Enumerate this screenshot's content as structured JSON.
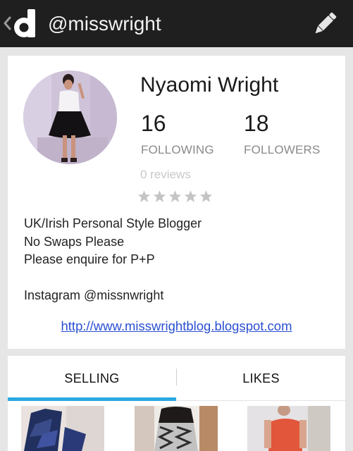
{
  "header": {
    "username": "@misswright",
    "back_icon": "chevron-left-icon",
    "logo_icon": "depop-d-logo",
    "edit_icon": "pencil-icon"
  },
  "profile": {
    "name": "Nyaomi Wright",
    "following_count": "16",
    "following_label": "FOLLOWING",
    "followers_count": "18",
    "followers_label": "FOLLOWERS",
    "reviews": "0 reviews",
    "rating": 0,
    "rating_max": 5,
    "bio": {
      "line1": "UK/Irish Personal Style Blogger",
      "line2": "No Swaps Please",
      "line3": "Please enquire for P+P",
      "line4": "",
      "line5": "Instagram @missnwright"
    },
    "website": "http://www.misswrightblog.blogspot.com"
  },
  "tabs": {
    "selling": "SELLING",
    "likes": "LIKES",
    "active": "selling"
  },
  "colors": {
    "topbar": "#1f1f1f",
    "accent": "#29a9e1",
    "link": "#2a4fd0",
    "muted": "#8a8a8a"
  },
  "items": [
    {
      "icon": "product-photo-blue-print-dress"
    },
    {
      "icon": "product-photo-patterned-trousers"
    },
    {
      "icon": "product-photo-coral-top"
    }
  ]
}
